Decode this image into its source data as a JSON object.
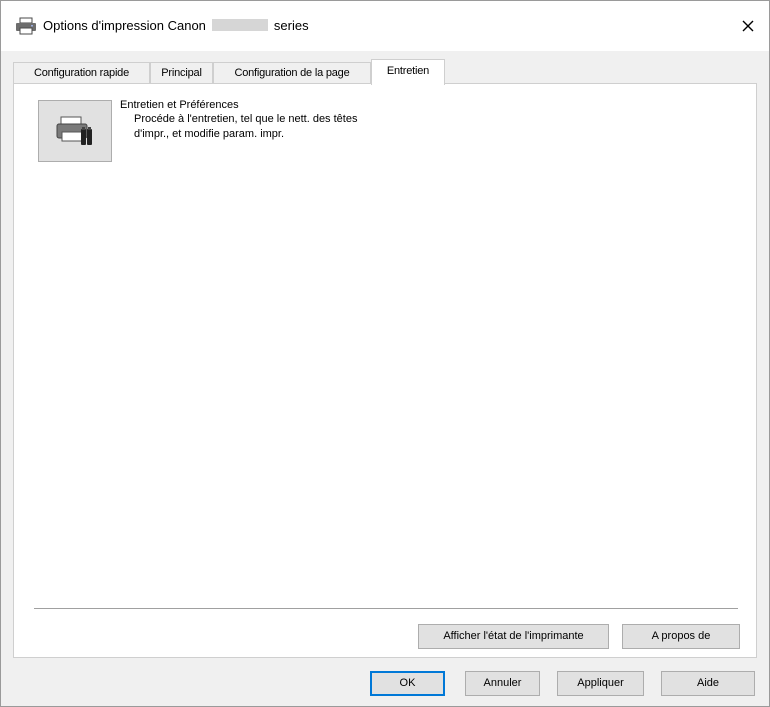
{
  "window": {
    "title_prefix": "Options d'impression Canon",
    "title_suffix": "series"
  },
  "tabs": [
    {
      "label": "Configuration rapide",
      "active": false
    },
    {
      "label": "Principal",
      "active": false
    },
    {
      "label": "Configuration de la page",
      "active": false
    },
    {
      "label": "Entretien",
      "active": true
    }
  ],
  "maintenance": {
    "title": "Entretien et Préférences",
    "description": "Procéde à l'entretien, tel que le nett. des têtes d'impr., et modifie param. impr."
  },
  "panel_buttons": {
    "printer_status": "Afficher l'état de l'imprimante",
    "about": "A propos de"
  },
  "dialog_buttons": {
    "ok": "OK",
    "cancel": "Annuler",
    "apply": "Appliquer",
    "help": "Aide"
  },
  "icons": {
    "title": "printer-icon",
    "close": "close-icon",
    "maintenance": "printer-maintenance-icon"
  },
  "colors": {
    "dialog_bg": "#f0f0f0",
    "panel_bg": "#ffffff",
    "button_bg": "#e1e1e1",
    "focus_border": "#0078d7"
  }
}
